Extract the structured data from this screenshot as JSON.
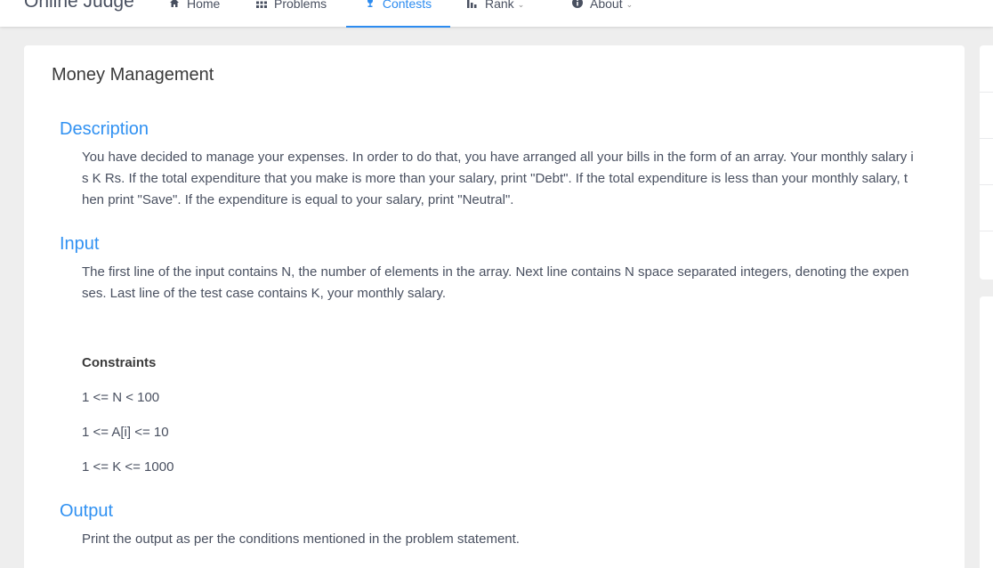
{
  "nav": {
    "brand": "Online Judge",
    "items": [
      {
        "label": "Home",
        "icon": "home-icon"
      },
      {
        "label": "Problems",
        "icon": "grid-icon"
      },
      {
        "label": "Contests",
        "icon": "trophy-icon",
        "active": true
      },
      {
        "label": "Rank",
        "icon": "bar-chart-icon"
      },
      {
        "label": "About",
        "icon": "info-icon"
      }
    ]
  },
  "problem": {
    "title": "Money Management",
    "description_title": "Description",
    "description": "You have decided to manage your expenses. In order to do that, you have arranged all your bills in the form of an array. Your monthly salary is K Rs. If the total expenditure that you make is more than your salary, print \"Debt\". If the total expenditure is less than your monthly salary, then print \"Save\". If the expenditure is equal to your salary, print \"Neutral\".",
    "input_title": "Input",
    "input": "The first line of the input contains N, the number of elements in the array. Next line contains N space separated integers, denoting the expenses. Last line of the test case contains K, your monthly salary.",
    "constraints_title": "Constraints",
    "constraints": [
      "1 <= N < 100",
      "1 <= A[i] <= 10",
      "1 <= K <= 1000"
    ],
    "output_title": "Output",
    "output": "Print the output as per the conditions mentioned in the problem statement."
  },
  "colors": {
    "accent": "#2d8cf0",
    "section_title": "#3091f2",
    "background": "#eeeeee"
  }
}
